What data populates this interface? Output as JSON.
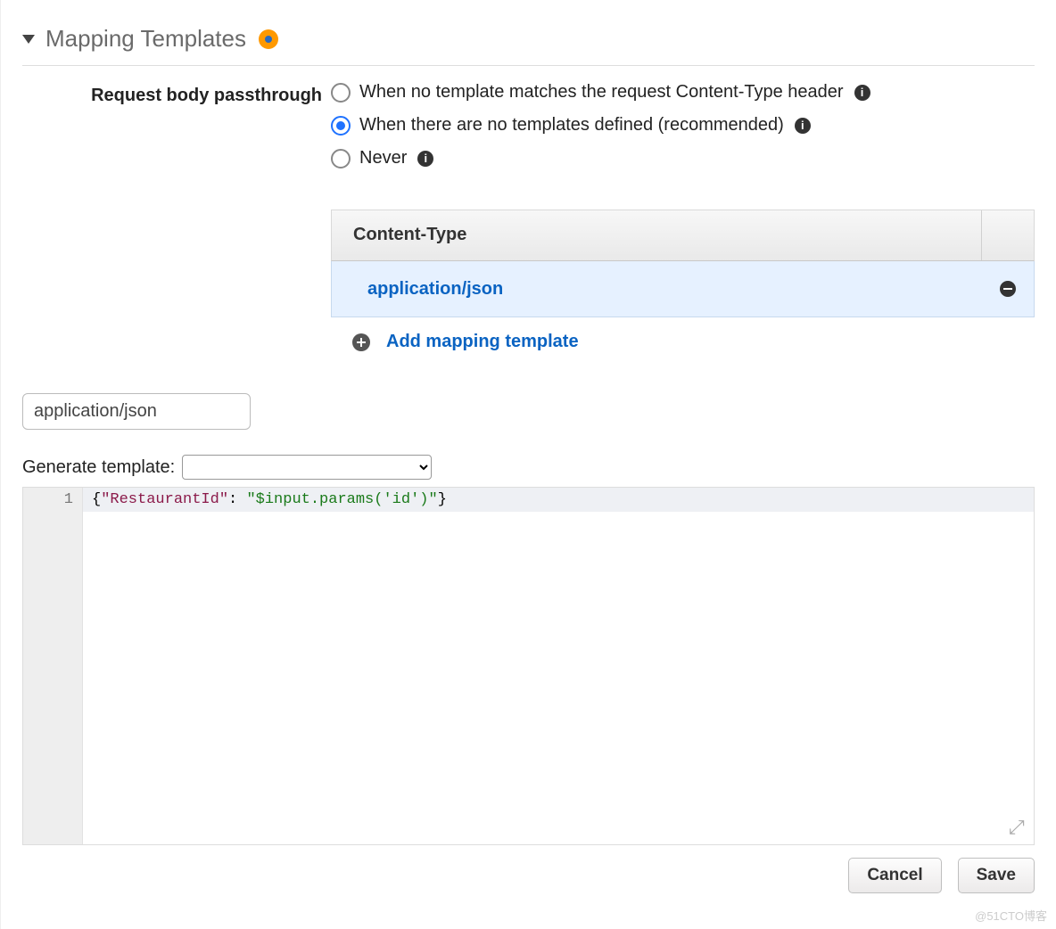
{
  "section": {
    "title": "Mapping Templates"
  },
  "passthrough": {
    "label": "Request body passthrough",
    "options": [
      {
        "label": "When no template matches the request Content-Type header",
        "selected": false
      },
      {
        "label": "When there are no templates defined (recommended)",
        "selected": true
      },
      {
        "label": "Never",
        "selected": false
      }
    ]
  },
  "content_type_table": {
    "header": "Content-Type",
    "rows": [
      {
        "value": "application/json"
      }
    ],
    "add_label": "Add mapping template"
  },
  "template_editor": {
    "name_value": "application/json",
    "generate_label": "Generate template:",
    "generate_selected": "",
    "code_raw": "{\"RestaurantId\": \"$input.params('id')\"}",
    "line_number": "1",
    "code_tokens": {
      "open": "{",
      "key": "\"RestaurantId\"",
      "colon": ": ",
      "val": "\"$input.params('id')\"",
      "close": "}"
    }
  },
  "buttons": {
    "cancel": "Cancel",
    "save": "Save"
  },
  "watermark": "@51CTO博客"
}
